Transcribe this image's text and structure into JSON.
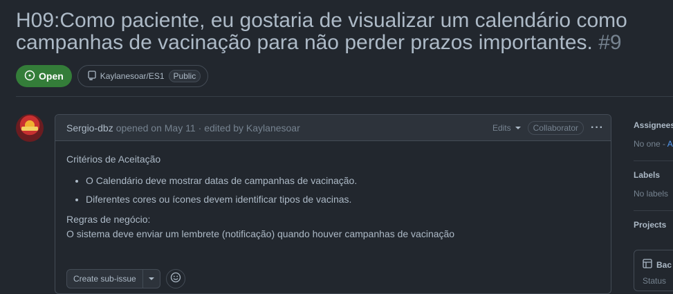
{
  "issue": {
    "title_line1": "H09:Como paciente, eu gostaria de visualizar um calendário como",
    "title_line2": "campanhas de vacinação para não perder prazos importantes.",
    "number": "#9",
    "state": "Open",
    "repo": "Kaylanesoar/ES1",
    "visibility": "Public"
  },
  "comment": {
    "author": "Sergio-dbz",
    "opened_text": "opened on May 11",
    "edited_text": "· edited by Kaylanesoar",
    "edits_label": "Edits",
    "role_badge": "Collaborator",
    "more_label": "···",
    "heading": "Critérios de Aceitação",
    "bullets": [
      "O Calendário deve mostrar datas de campanhas de vacinação.",
      "Diferentes cores ou ícones devem identificar tipos de vacinas."
    ],
    "rules_title": "Regras de negócio:",
    "rules_text": "O sistema deve enviar um lembrete (notificação) quando houver campanhas de vacinação",
    "create_subissue_label": "Create sub-issue"
  },
  "sidebar": {
    "assignees_label": "Assignees",
    "assignees_value": "No one -",
    "assignees_link": "A",
    "labels_label": "Labels",
    "labels_value": "No labels",
    "projects_label": "Projects",
    "project_name": "Bac",
    "project_status_label": "Status"
  },
  "colors": {
    "background": "#22272e",
    "open_green": "#347d39",
    "link_blue": "#539bf5"
  },
  "icons": [
    "issue-opened-icon",
    "repo-icon",
    "triangle-down-icon",
    "kebab-horizontal-icon",
    "smiley-icon",
    "table-icon"
  ]
}
